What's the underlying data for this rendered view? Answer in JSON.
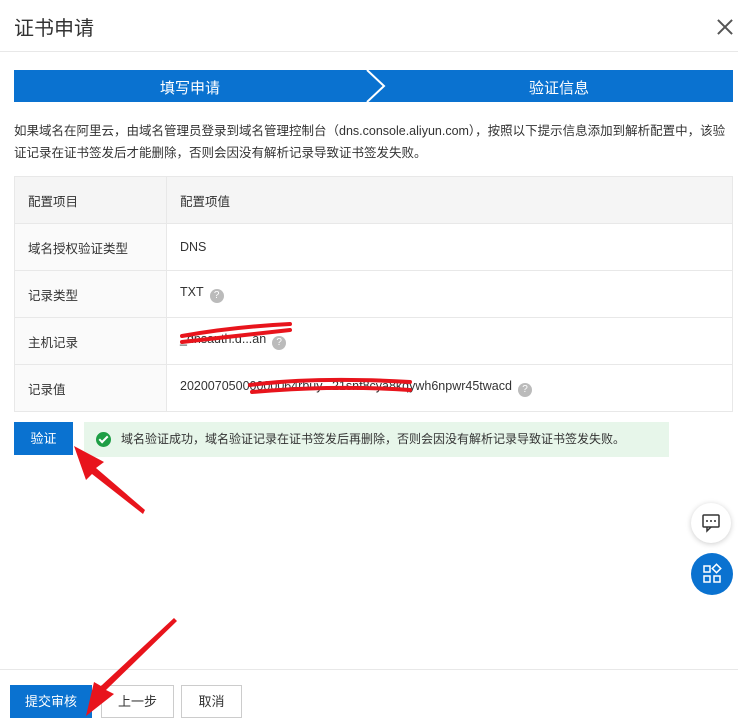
{
  "dialog": {
    "title": "证书申请"
  },
  "steps": [
    {
      "label": "填写申请"
    },
    {
      "label": "验证信息"
    }
  ],
  "description": "如果域名在阿里云，由域名管理员登录到域名管理控制台（dns.console.aliyun.com），按照以下提示信息添加到解析配置中，该验证记录在证书签发后才能删除，否则会因没有解析记录导致证书签发失败。",
  "table": {
    "headers": {
      "key": "配置项目",
      "value": "配置项值"
    },
    "rows": [
      {
        "key": "域名授权验证类型",
        "value": "DNS"
      },
      {
        "key": "记录类型",
        "value": "TXT"
      },
      {
        "key": "主机记录",
        "value": "_dnsauth.d...an"
      },
      {
        "key": "记录值",
        "value": "20200705000000064rbuy...21snf8cya8kqywh6npwr45twacd"
      }
    ]
  },
  "verify": {
    "button_label": "验证",
    "success_message": "域名验证成功，域名验证记录在证书签发后再删除，否则会因没有解析记录导致证书签发失败。"
  },
  "footer": {
    "submit_label": "提交审核",
    "prev_label": "上一步",
    "cancel_label": "取消"
  },
  "colors": {
    "primary": "#0a72d0",
    "success_bg": "#e7f6ea",
    "success_icon": "#1e9e45",
    "redaction": "#e8141c"
  }
}
